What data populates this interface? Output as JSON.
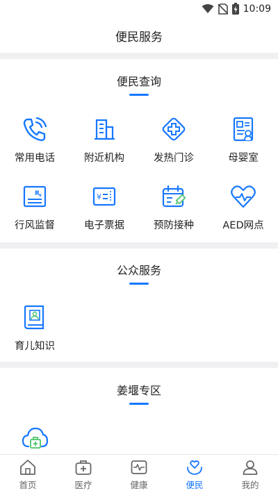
{
  "status": {
    "time": "10:09"
  },
  "header": {
    "title": "便民服务"
  },
  "sections": [
    {
      "title": "便民查询",
      "items": [
        {
          "label": "常用电话",
          "icon": "phone-icon"
        },
        {
          "label": "附近机构",
          "icon": "building-icon"
        },
        {
          "label": "发热门诊",
          "icon": "medical-cross-icon"
        },
        {
          "label": "母婴室",
          "icon": "nursery-card-icon"
        },
        {
          "label": "行风监督",
          "icon": "prescription-icon"
        },
        {
          "label": "电子票据",
          "icon": "e-ticket-icon"
        },
        {
          "label": "预防接种",
          "icon": "vaccine-calendar-icon"
        },
        {
          "label": "AED网点",
          "icon": "heart-pulse-icon"
        }
      ]
    },
    {
      "title": "公众服务",
      "items": [
        {
          "label": "育儿知识",
          "icon": "parenting-book-icon"
        }
      ]
    },
    {
      "title": "姜堰专区",
      "items": [
        {
          "label": "",
          "icon": "cloud-medkit-icon"
        }
      ]
    }
  ],
  "tabbar": [
    {
      "label": "首页",
      "icon": "home-icon",
      "active": false
    },
    {
      "label": "医疗",
      "icon": "medkit-icon",
      "active": false
    },
    {
      "label": "健康",
      "icon": "pulse-monitor-icon",
      "active": false
    },
    {
      "label": "便民",
      "icon": "heart-hands-icon",
      "active": true
    },
    {
      "label": "我的",
      "icon": "user-icon",
      "active": false
    }
  ],
  "colors": {
    "accent": "#1677ff",
    "divider": "#f0f0f2",
    "text": "#222222"
  }
}
